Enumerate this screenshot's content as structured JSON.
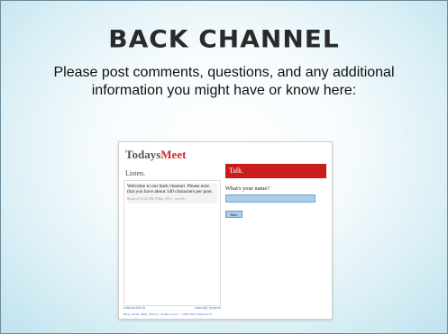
{
  "slide": {
    "title": "BACK CHANNEL",
    "subtitle": "Please post comments, questions, and any additional information you might have or know here:"
  },
  "screenshot": {
    "logo_part1": "Todays",
    "logo_part2": "Meet",
    "listen_label": "Listen.",
    "welcome_message": "Welcome to our back channel. Please note that you have about 140 characters per post.",
    "welcome_stamp": "Room at 10:24 AM, 8 May 2013 · on web",
    "link_left": "today.ms/bshs ⚙",
    "link_right": "transcript | projector",
    "footer": "Blog | About | Help | Privacy | Terms of Use | © 2008–2013 James Socol.",
    "talk_label": "Talk.",
    "name_prompt": "What's your name?",
    "name_value": "",
    "join_label": "Join."
  },
  "colors": {
    "brand_red": "#c91d1d",
    "field_blue": "#a9cdea",
    "link_blue": "#3a6fc4"
  }
}
